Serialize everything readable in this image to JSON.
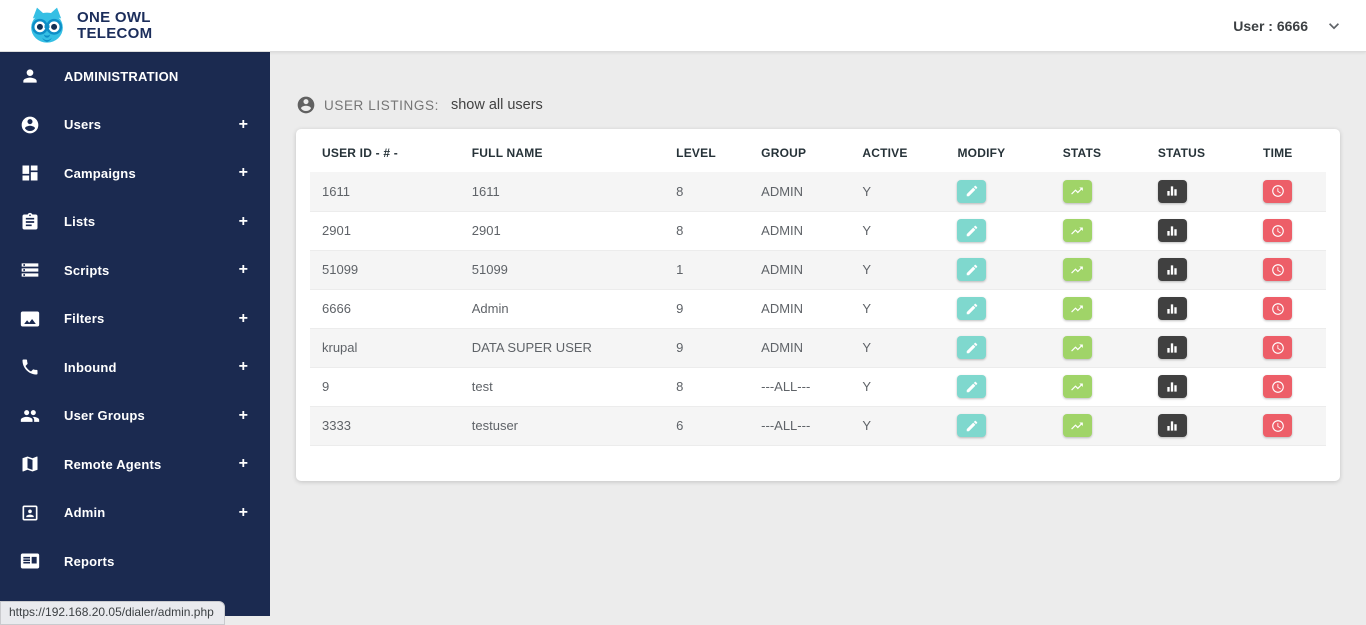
{
  "header": {
    "logo": {
      "icon": "owl-icon",
      "line1": "ONE OWL",
      "line2": "TELECOM"
    },
    "user_menu": {
      "label": "User : 6666",
      "icon": "chevron-down-icon"
    }
  },
  "sidebar": {
    "expand_glyph": "+",
    "items": [
      {
        "label": "ADMINISTRATION",
        "icon": "person-icon",
        "expandable": false
      },
      {
        "label": "Users",
        "icon": "account-circle-icon",
        "expandable": true
      },
      {
        "label": "Campaigns",
        "icon": "dashboard-icon",
        "expandable": true
      },
      {
        "label": "Lists",
        "icon": "clipboard-icon",
        "expandable": true
      },
      {
        "label": "Scripts",
        "icon": "stack-icon",
        "expandable": true
      },
      {
        "label": "Filters",
        "icon": "image-filter-icon",
        "expandable": true
      },
      {
        "label": "Inbound",
        "icon": "phone-icon",
        "expandable": true
      },
      {
        "label": "User Groups",
        "icon": "people-icon",
        "expandable": true
      },
      {
        "label": "Remote Agents",
        "icon": "map-icon",
        "expandable": true
      },
      {
        "label": "Admin",
        "icon": "badge-icon",
        "expandable": true
      },
      {
        "label": "Reports",
        "icon": "report-list-icon",
        "expandable": false
      }
    ]
  },
  "status_tooltip": {
    "url": "https://192.168.20.05/dialer/admin.php"
  },
  "main": {
    "listing_header": {
      "icon": "account-circle-icon",
      "title": "USER LISTINGS:",
      "link": "show all users"
    },
    "table": {
      "columns": [
        "USER ID - # -",
        "FULL NAME",
        "LEVEL",
        "GROUP",
        "ACTIVE",
        "MODIFY",
        "STATS",
        "STATUS",
        "TIME"
      ],
      "action_icons": {
        "modify": "pencil-icon",
        "stats": "trending-up-icon",
        "status": "bar-chart-icon",
        "time": "clock-icon"
      },
      "rows": [
        {
          "user_id": "1611",
          "full_name": "1611",
          "level": "8",
          "group": "ADMIN",
          "active": "Y"
        },
        {
          "user_id": "2901",
          "full_name": "2901",
          "level": "8",
          "group": "ADMIN",
          "active": "Y"
        },
        {
          "user_id": "51099",
          "full_name": "51099",
          "level": "1",
          "group": "ADMIN",
          "active": "Y"
        },
        {
          "user_id": "6666",
          "full_name": "Admin",
          "level": "9",
          "group": "ADMIN",
          "active": "Y"
        },
        {
          "user_id": "krupal",
          "full_name": "DATA SUPER USER",
          "level": "9",
          "group": "ADMIN",
          "active": "Y"
        },
        {
          "user_id": "9",
          "full_name": "test",
          "level": "8",
          "group": "---ALL---",
          "active": "Y"
        },
        {
          "user_id": "3333",
          "full_name": "testuser",
          "level": "6",
          "group": "---ALL---",
          "active": "Y"
        }
      ]
    }
  },
  "colors": {
    "sidebar_bg": "#1b2a50",
    "logo_blue": "#35bfe4",
    "logo_navy": "#1b2d5b",
    "modify_btn": "#7fd8ce",
    "stats_btn": "#a0d468",
    "status_btn": "#404040",
    "time_btn": "#ed5e68",
    "row_stripe": "#f5f5f5"
  }
}
